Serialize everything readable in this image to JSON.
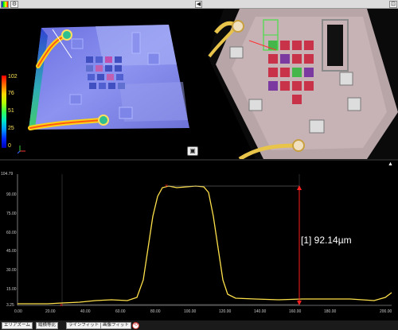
{
  "toolbar": {
    "colormap_icon": "colormap-icon",
    "settings_icon": "gear-icon",
    "collapse_symbol": "◀",
    "pin_symbol": "⊡"
  },
  "view3d": {
    "legend_ticks": [
      "102",
      "76",
      "51",
      "25",
      "0"
    ],
    "snapshot_symbol": "▣"
  },
  "profile": {
    "expand_symbol": "▲",
    "y_axis_ticks": [
      "104.79",
      "90.00",
      "75.00",
      "60.00",
      "45.00",
      "30.00",
      "15.00",
      "3.25"
    ],
    "x_axis_ticks": [
      "0.00",
      "20.00",
      "40.00",
      "60.00",
      "80.00",
      "100.00",
      "120.00",
      "140.00",
      "160.00",
      "180.00",
      "200.00",
      "215.00"
    ],
    "measurement_label": "[1] 92.14µm",
    "colors": {
      "trace": "#ffe14a",
      "marker": "#ff2020",
      "axis": "#cccccc"
    }
  },
  "bottom_toolbar": {
    "buttons": [
      "エリアズーム",
      "縦横等比",
      "ラインフィット",
      "画像フィット"
    ],
    "reset_symbol": "⟲"
  }
}
